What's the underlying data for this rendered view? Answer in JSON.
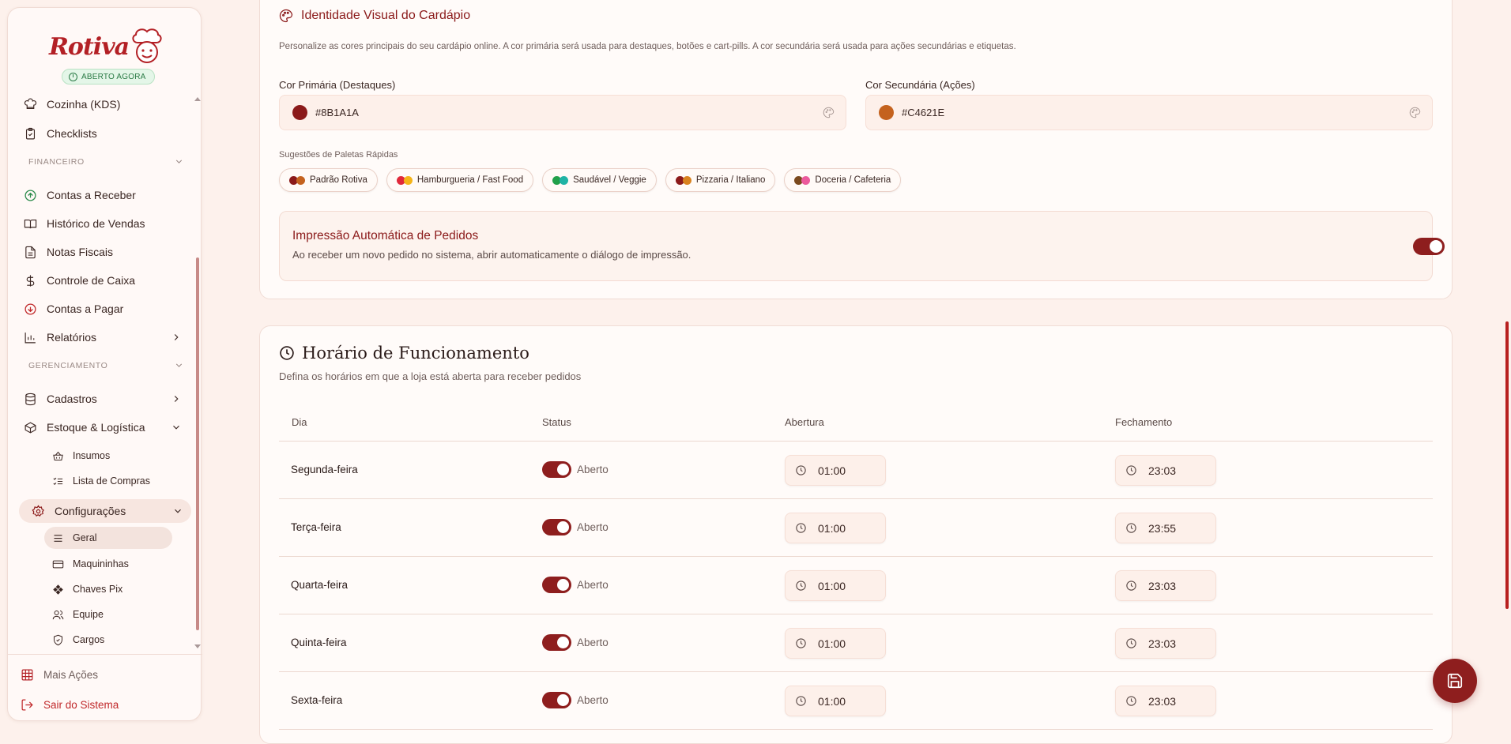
{
  "sidebar": {
    "brand": "Rotiva",
    "status_badge": "ABERTO AGORA",
    "items_top": [
      "Cozinha (KDS)",
      "Checklists"
    ],
    "section_financeiro": "FINANCEIRO",
    "financeiro": [
      "Contas a Receber",
      "Histórico de Vendas",
      "Notas Fiscais",
      "Controle de Caixa",
      "Contas a Pagar",
      "Relatórios"
    ],
    "section_gerenciamento": "GERENCIAMENTO",
    "gerenciamento": [
      "Cadastros",
      "Estoque & Logística"
    ],
    "estoque_sub": [
      "Insumos",
      "Lista de Compras"
    ],
    "config": "Configurações",
    "config_sub": [
      "Geral",
      "Maquininhas",
      "Chaves Pix",
      "Equipe",
      "Cargos"
    ],
    "footer": [
      "Mais Ações",
      "Sair do Sistema"
    ]
  },
  "visual": {
    "title": "Identidade Visual do Cardápio",
    "description": "Personalize as cores principais do seu cardápio online. A cor primária será usada para destaques, botões e cart-pills. A cor secundária será usada para ações secundárias e etiquetas.",
    "primary_label": "Cor Primária (Destaques)",
    "primary_value": "#8B1A1A",
    "secondary_label": "Cor Secundária (Ações)",
    "secondary_value": "#C4621E",
    "suggestions_label": "Sugestões de Paletas Rápidas",
    "palettes": [
      {
        "name": "Padrão Rotiva",
        "colors": [
          "#8b1a1a",
          "#c4621e"
        ]
      },
      {
        "name": "Hamburgueria / Fast Food",
        "colors": [
          "#e0283a",
          "#f5b418"
        ]
      },
      {
        "name": "Saudável / Veggie",
        "colors": [
          "#21a04a",
          "#1fb3a5"
        ]
      },
      {
        "name": "Pizzaria / Italiano",
        "colors": [
          "#8b1a1a",
          "#d9821e"
        ]
      },
      {
        "name": "Doceria / Cafeteria",
        "colors": [
          "#7a4a1e",
          "#ec5a9c"
        ]
      }
    ],
    "print_title": "Impressão Automática de Pedidos",
    "print_desc": "Ao receber um novo pedido no sistema, abrir automaticamente o diálogo de impressão."
  },
  "hours": {
    "title": "Horário de Funcionamento",
    "description": "Defina os horários em que a loja está aberta para receber pedidos",
    "columns": [
      "Dia",
      "Status",
      "Abertura",
      "Fechamento"
    ],
    "rows": [
      {
        "day": "Segunda-feira",
        "status": "Aberto",
        "open": "01:00",
        "close": "23:03"
      },
      {
        "day": "Terça-feira",
        "status": "Aberto",
        "open": "01:00",
        "close": "23:55"
      },
      {
        "day": "Quarta-feira",
        "status": "Aberto",
        "open": "01:00",
        "close": "23:03"
      },
      {
        "day": "Quinta-feira",
        "status": "Aberto",
        "open": "01:00",
        "close": "23:03"
      },
      {
        "day": "Sexta-feira",
        "status": "Aberto",
        "open": "01:00",
        "close": "23:03"
      }
    ]
  },
  "colors": {
    "primary": "#8B1A1A",
    "secondary": "#C4621E"
  }
}
